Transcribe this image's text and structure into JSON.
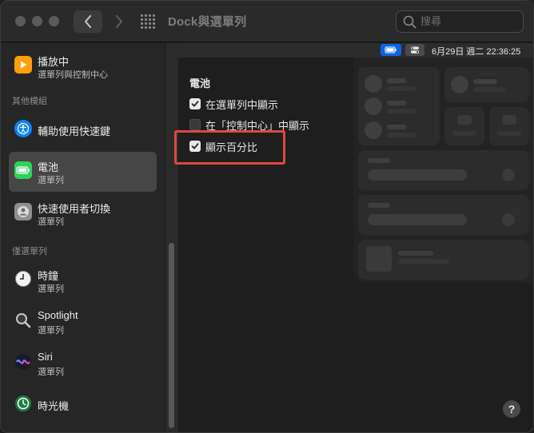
{
  "window": {
    "title": "Dock與選單列"
  },
  "search": {
    "placeholder": "搜尋"
  },
  "sidebar": {
    "items": [
      {
        "label": "播放中",
        "sub": "選單列與控制中心",
        "icon": "now-playing-icon",
        "color": "#ff9f0a"
      },
      {
        "label": "輔助使用快速鍵",
        "sub": "",
        "icon": "accessibility-icon",
        "color": "#0a84ff"
      },
      {
        "label": "電池",
        "sub": "選單列",
        "icon": "battery-icon",
        "color": "#30d158"
      },
      {
        "label": "快速使用者切換",
        "sub": "選單列",
        "icon": "user-switch-icon",
        "color": "#8e8e93"
      },
      {
        "label": "時鐘",
        "sub": "選單列",
        "icon": "clock-icon",
        "color": "#8e8e93"
      },
      {
        "label": "Spotlight",
        "sub": "選單列",
        "icon": "spotlight-icon",
        "color": "#8e8e93"
      },
      {
        "label": "Siri",
        "sub": "選單列",
        "icon": "siri-icon",
        "color": "#bf5af2"
      },
      {
        "label": "時光機",
        "sub": "",
        "icon": "time-machine-icon",
        "color": "#2b8a4e"
      }
    ],
    "sections": {
      "other_modules": "其他模組",
      "menu_bar_only": "僅選單列"
    }
  },
  "menubar_preview": {
    "clock": "6月29日 週二  22:36:25"
  },
  "battery": {
    "title": "電池",
    "options": [
      {
        "label": "在選單列中顯示",
        "checked": true
      },
      {
        "label": "在「控制中心」中顯示",
        "checked": false
      },
      {
        "label": "顯示百分比",
        "checked": true
      }
    ]
  },
  "help": {
    "label": "?"
  },
  "colors": {
    "accent": "#0a66e0",
    "highlight": "#e0483f"
  }
}
